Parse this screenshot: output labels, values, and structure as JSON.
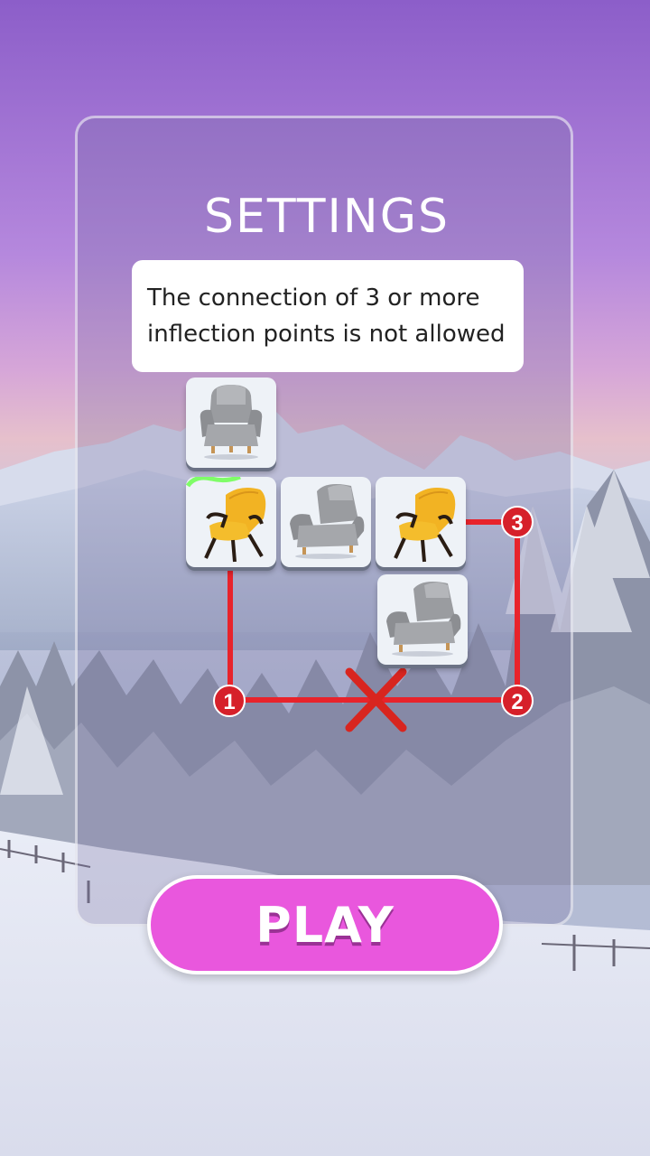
{
  "settings": {
    "title": "SETTINGS",
    "tip": "The connection of 3 or more inflection points is not allowed"
  },
  "illustration": {
    "tiles": [
      {
        "item": "grey-armchair-icon"
      },
      {
        "item": "yellow-armchair-icon",
        "selected": true
      },
      {
        "item": "grey-armchair-icon"
      },
      {
        "item": "yellow-armchair-icon"
      },
      {
        "item": "grey-armchair-icon"
      }
    ],
    "inflection_points": [
      "1",
      "2",
      "3"
    ],
    "invalid_marker": "cross-icon"
  },
  "play_button": {
    "label": "PLAY"
  },
  "colors": {
    "path_red": "#e8232b",
    "badge_red": "#d6202a",
    "play_pink": "#e957dd",
    "glow_green": "#6bff4f"
  }
}
